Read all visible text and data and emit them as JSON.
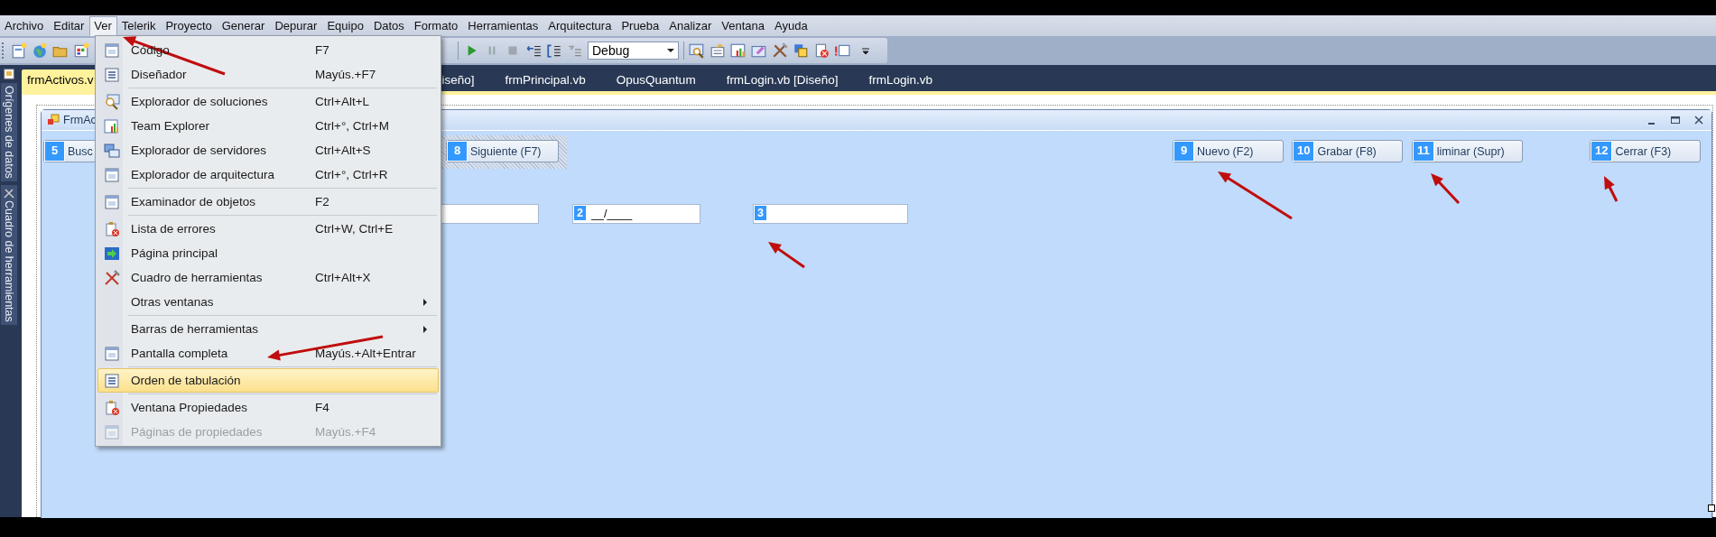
{
  "menu_bar": [
    {
      "label": "Archivo",
      "selected": false
    },
    {
      "label": "Editar",
      "selected": false
    },
    {
      "label": "Ver",
      "selected": true
    },
    {
      "label": "Telerik",
      "selected": false
    },
    {
      "label": "Proyecto",
      "selected": false
    },
    {
      "label": "Generar",
      "selected": false
    },
    {
      "label": "Depurar",
      "selected": false
    },
    {
      "label": "Equipo",
      "selected": false
    },
    {
      "label": "Datos",
      "selected": false
    },
    {
      "label": "Formato",
      "selected": false
    },
    {
      "label": "Herramientas",
      "selected": false
    },
    {
      "label": "Arquitectura",
      "selected": false
    },
    {
      "label": "Prueba",
      "selected": false
    },
    {
      "label": "Analizar",
      "selected": false
    },
    {
      "label": "Ventana",
      "selected": false
    },
    {
      "label": "Ayuda",
      "selected": false
    }
  ],
  "toolbar": {
    "configuration": "Debug"
  },
  "document_tabs": [
    {
      "label": "frmActivos.v",
      "selected": true
    },
    {
      "label": "iseño]",
      "selected": false
    },
    {
      "label": "frmPrincipal.vb",
      "selected": false
    },
    {
      "label": "OpusQuantum",
      "selected": false
    },
    {
      "label": "frmLogin.vb [Diseño]",
      "selected": false
    },
    {
      "label": "frmLogin.vb",
      "selected": false
    }
  ],
  "side_panel": [
    "Orígenes de datos",
    "Cuadro de herramientas"
  ],
  "form": {
    "title": "FrmAc",
    "buttons": [
      {
        "tab_index": "5",
        "label": "Busc"
      },
      {
        "tab_index": "8",
        "label": "Siguiente (F7)"
      },
      {
        "tab_index": "9",
        "label": "Nuevo (F2)"
      },
      {
        "tab_index": "10",
        "label": "Grabar (F8)"
      },
      {
        "tab_index": "11",
        "label": "liminar (Supr)"
      },
      {
        "tab_index": "12",
        "label": "Cerrar (F3)"
      }
    ],
    "fields": [
      {
        "kind": "text"
      },
      {
        "kind": "text",
        "tab_index": "2",
        "value": "__/____"
      },
      {
        "kind": "text",
        "tab_index": "3"
      }
    ]
  },
  "view_menu": {
    "groups": [
      [
        {
          "label": "Código",
          "shortcut": "F7",
          "submenu": false,
          "disabled": false,
          "selected": false
        },
        {
          "label": "Diseñador",
          "shortcut": "Mayús.+F7",
          "submenu": false,
          "disabled": false,
          "selected": false
        }
      ],
      [
        {
          "label": "Explorador de soluciones",
          "shortcut": "Ctrl+Alt+L",
          "submenu": false,
          "disabled": false,
          "selected": false
        },
        {
          "label": "Team Explorer",
          "shortcut": "Ctrl+°, Ctrl+M",
          "submenu": false,
          "disabled": false,
          "selected": false
        },
        {
          "label": "Explorador de servidores",
          "shortcut": "Ctrl+Alt+S",
          "submenu": false,
          "disabled": false,
          "selected": false
        },
        {
          "label": "Explorador de arquitectura",
          "shortcut": "Ctrl+°, Ctrl+R",
          "submenu": false,
          "disabled": false,
          "selected": false
        }
      ],
      [
        {
          "label": "Examinador de objetos",
          "shortcut": "F2",
          "submenu": false,
          "disabled": false,
          "selected": false
        }
      ],
      [
        {
          "label": "Lista de errores",
          "shortcut": "Ctrl+W, Ctrl+E",
          "submenu": false,
          "disabled": false,
          "selected": false
        },
        {
          "label": "Página principal",
          "submenu": false,
          "disabled": false,
          "selected": false
        },
        {
          "label": "Cuadro de herramientas",
          "shortcut": "Ctrl+Alt+X",
          "submenu": false,
          "disabled": false,
          "selected": false
        },
        {
          "label": "Otras ventanas",
          "submenu": true,
          "disabled": false,
          "selected": false
        }
      ],
      [
        {
          "label": "Barras de herramientas",
          "submenu": true,
          "disabled": false,
          "selected": false
        },
        {
          "label": "Pantalla completa",
          "shortcut": "Mayús.+Alt+Entrar",
          "submenu": false,
          "disabled": false,
          "selected": false
        }
      ],
      [
        {
          "label": "Orden de tabulación",
          "submenu": false,
          "disabled": false,
          "selected": true
        }
      ],
      [
        {
          "label": "Ventana Propiedades",
          "shortcut": "F4",
          "submenu": false,
          "disabled": false,
          "selected": false
        },
        {
          "label": "Páginas de propiedades",
          "shortcut": "Mayús.+F4",
          "submenu": false,
          "disabled": true,
          "selected": false
        }
      ]
    ]
  }
}
